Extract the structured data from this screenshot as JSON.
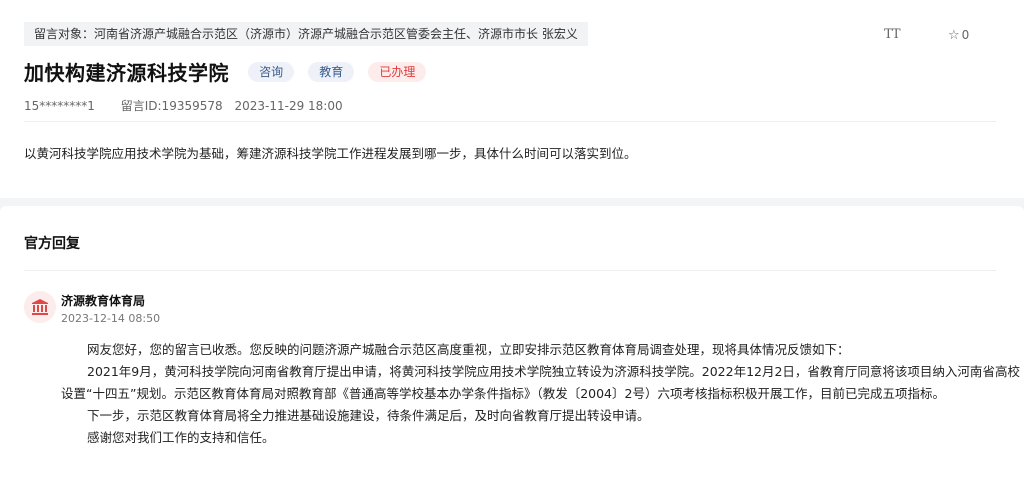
{
  "message": {
    "target_label": "留言对象：河南省济源产城融合示范区（济源市）济源产城融合示范区管委会主任、济源市市长 张宏义",
    "font_toggle_label": "TT",
    "star_count": "0",
    "title": "加快构建济源科技学院",
    "tags": [
      "咨询",
      "教育",
      "已办理"
    ],
    "author": "15********1",
    "message_id": "留言ID:19359578",
    "datetime": "2023-11-29 18:00",
    "content": "以黄河科技学院应用技术学院为基础，筹建济源科技学院工作进程发展到哪一步，具体什么时间可以落实到位。"
  },
  "reply": {
    "section_title": "官方回复",
    "department": "济源教育体育局",
    "date": "2023-12-14 08:50",
    "paragraphs": [
      "网友您好，您的留言已收悉。您反映的问题济源产城融合示范区高度重视，立即安排示范区教育体育局调查处理，现将具体情况反馈如下：",
      "2021年9月，黄河科技学院向河南省教育厅提出申请，将黄河科技学院应用技术学院独立转设为济源科技学院。2022年12月2日，省教育厅同意将该项目纳入河南省高校",
      "设置“十四五”规划。示范区教育体育局对照教育部《普通高等学校基本办学条件指标》（教发〔2004〕2号）六项考核指标积极开展工作，目前已完成五项指标。",
      "下一步，示范区教育体育局将全力推进基础设施建设，待条件满足后，及时向省教育厅提出转设申请。",
      "感谢您对我们工作的支持和信任。"
    ]
  },
  "colors": {
    "tag_category_bg": "#eef2f8",
    "tag_done_text": "#e03b3b",
    "avatar_bg": "#fdecec"
  },
  "icons": {
    "font_size": "font-size-icon",
    "star": "star-icon",
    "avatar": "government-building-icon"
  }
}
